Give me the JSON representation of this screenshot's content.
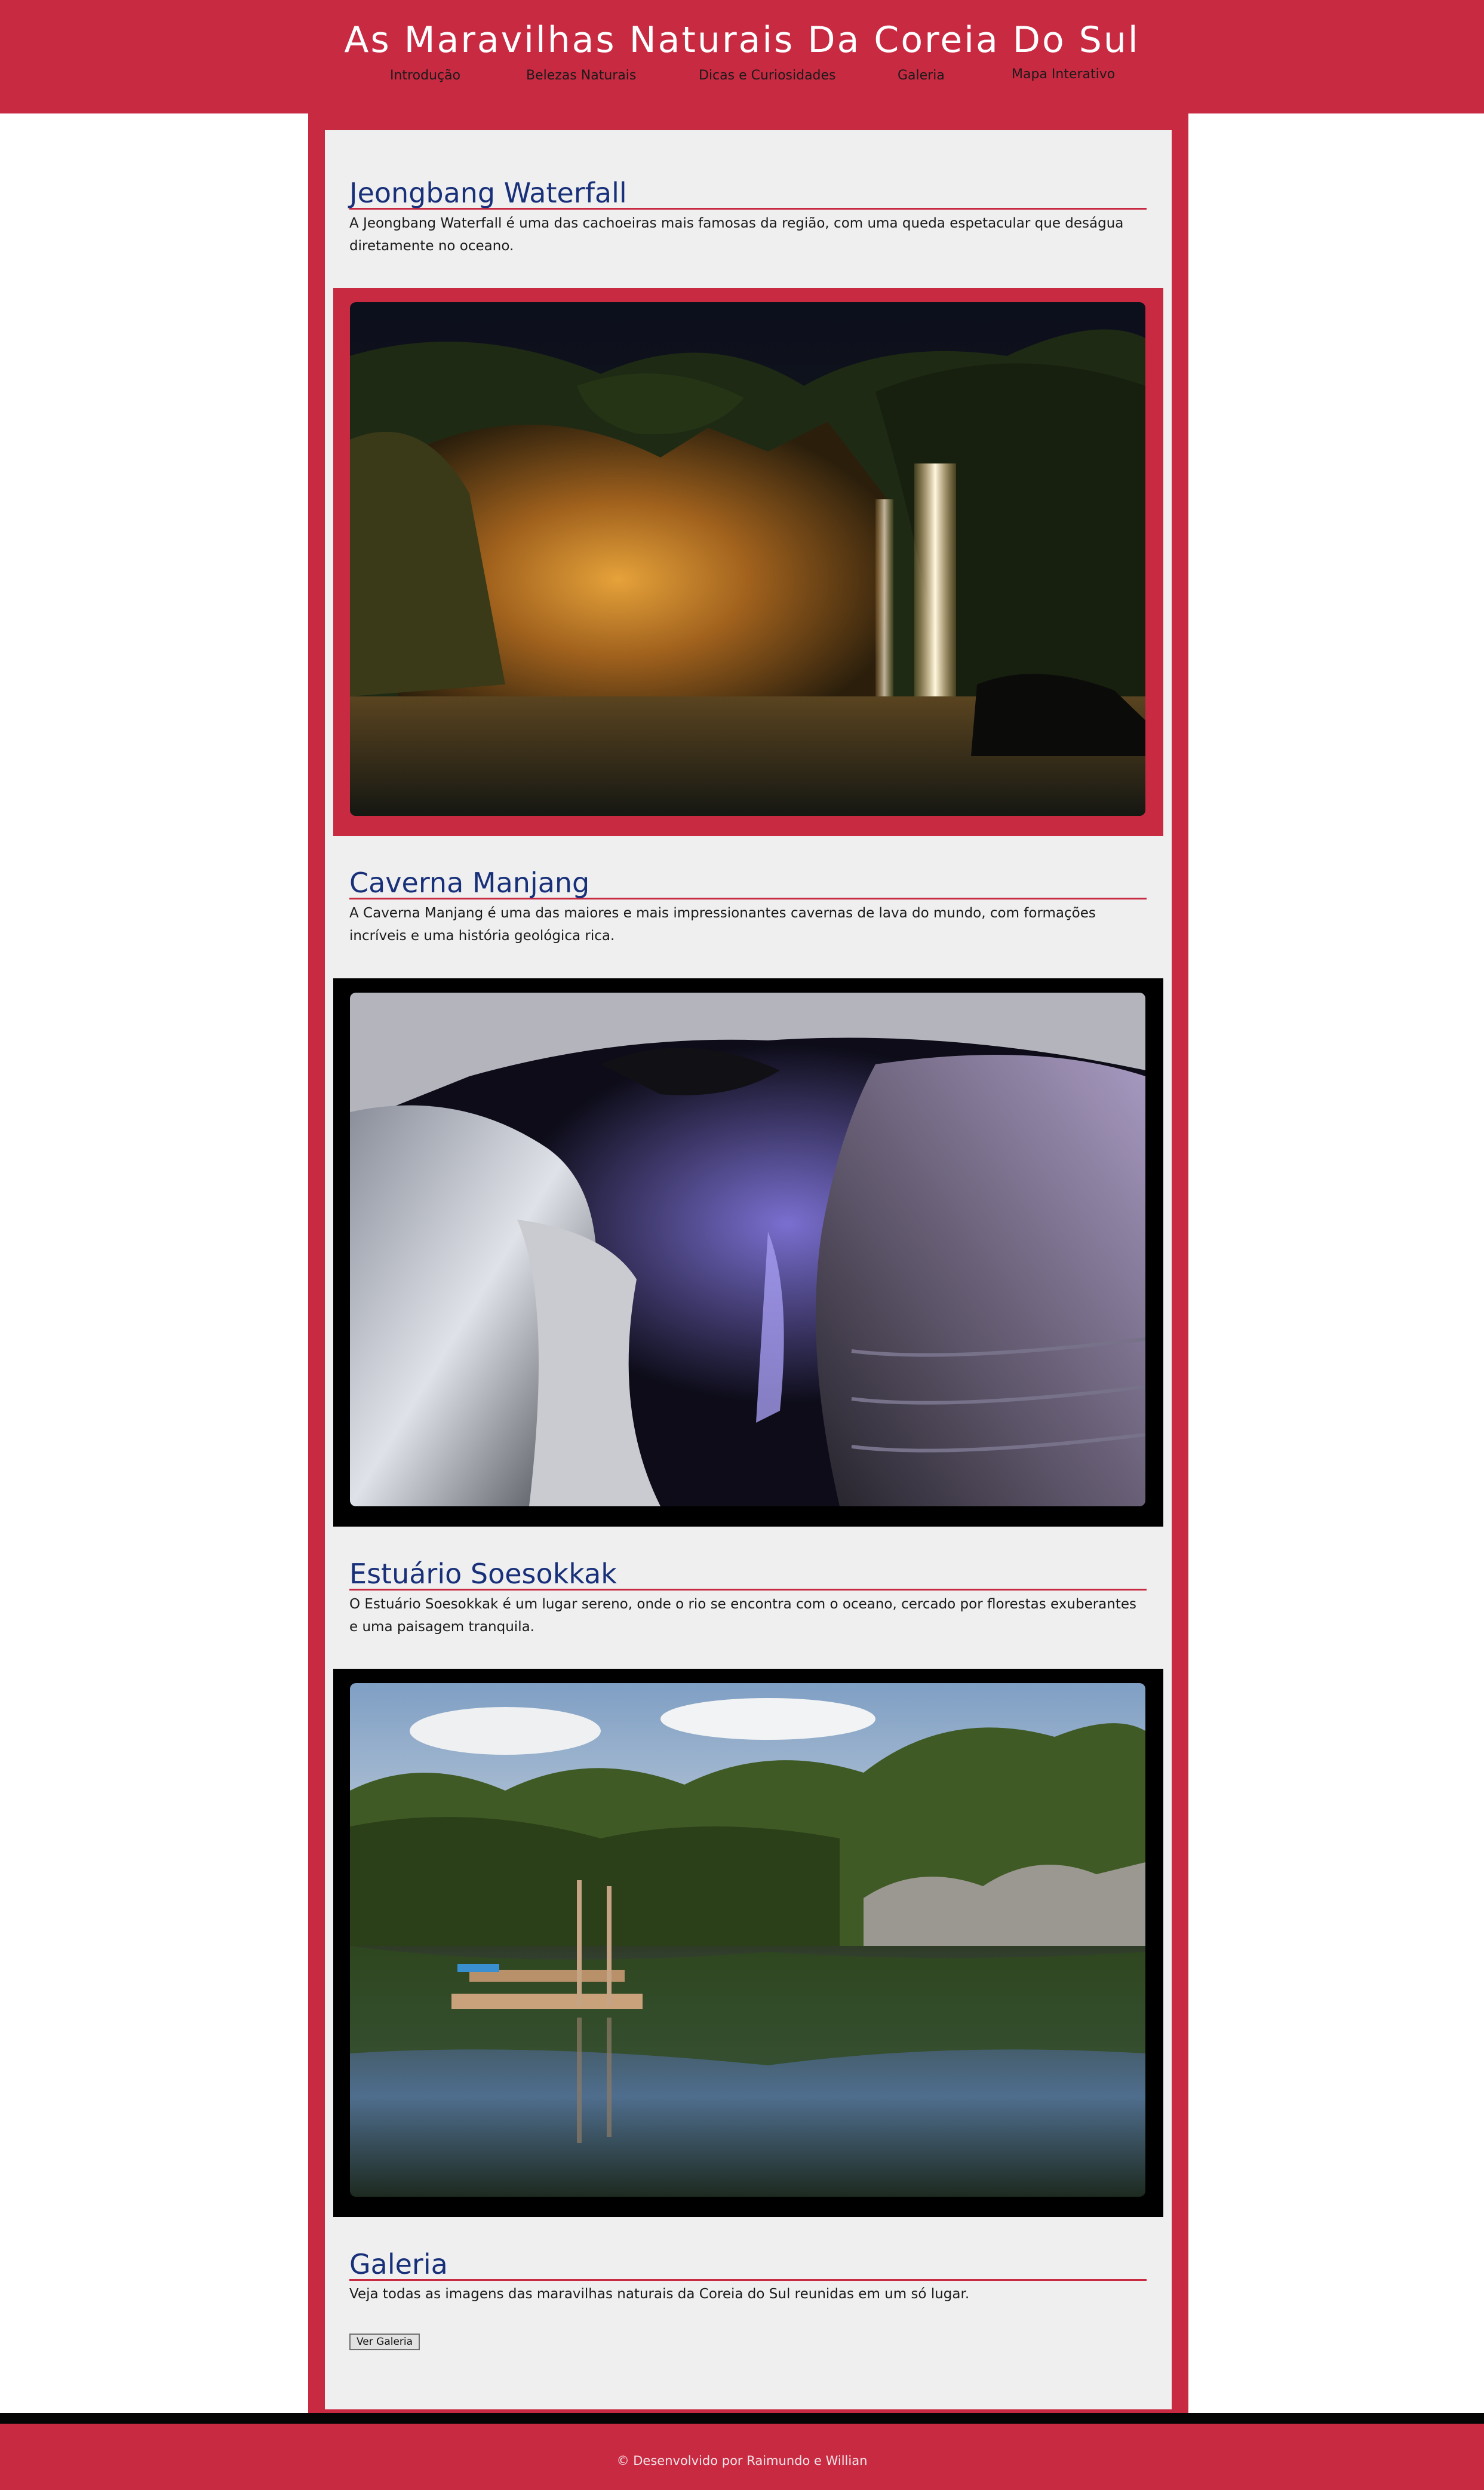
{
  "header": {
    "title": "As Maravilhas Naturais Da Coreia Do Sul",
    "nav": [
      "Introdução",
      "Belezas Naturais",
      "Dicas e Curiosidades",
      "Galeria",
      "Mapa Interativo"
    ]
  },
  "sections": [
    {
      "title": "Jeongbang Waterfall",
      "text": "A Jeongbang Waterfall é uma das cachoeiras mais famosas da região, com uma queda espetacular que deságua diretamente no oceano.",
      "image": "waterfall-photo",
      "frame_color": "#c82a42"
    },
    {
      "title": "Caverna Manjang",
      "text": "A Caverna Manjang é uma das maiores e mais impressionantes cavernas de lava do mundo, com formações incríveis e uma história geológica rica.",
      "image": "lava-cave-photo",
      "frame_color": "#000000"
    },
    {
      "title": "Estuário Soesokkak",
      "text": "O Estuário Soesokkak é um lugar sereno, onde o rio se encontra com o oceano, cercado por florestas exuberantes e uma paisagem tranquila.",
      "image": "estuary-photo",
      "frame_color": "#000000"
    },
    {
      "title": "Galeria",
      "text": "Veja todas as imagens das maravilhas naturais da Coreia do Sul reunidas em um só lugar.",
      "button": "Ver Galeria"
    }
  ],
  "footer": {
    "text": "© Desenvolvido por Raimundo e Willian"
  },
  "colors": {
    "brand": "#c82a42",
    "heading": "#18307a",
    "panel": "#efefef"
  }
}
